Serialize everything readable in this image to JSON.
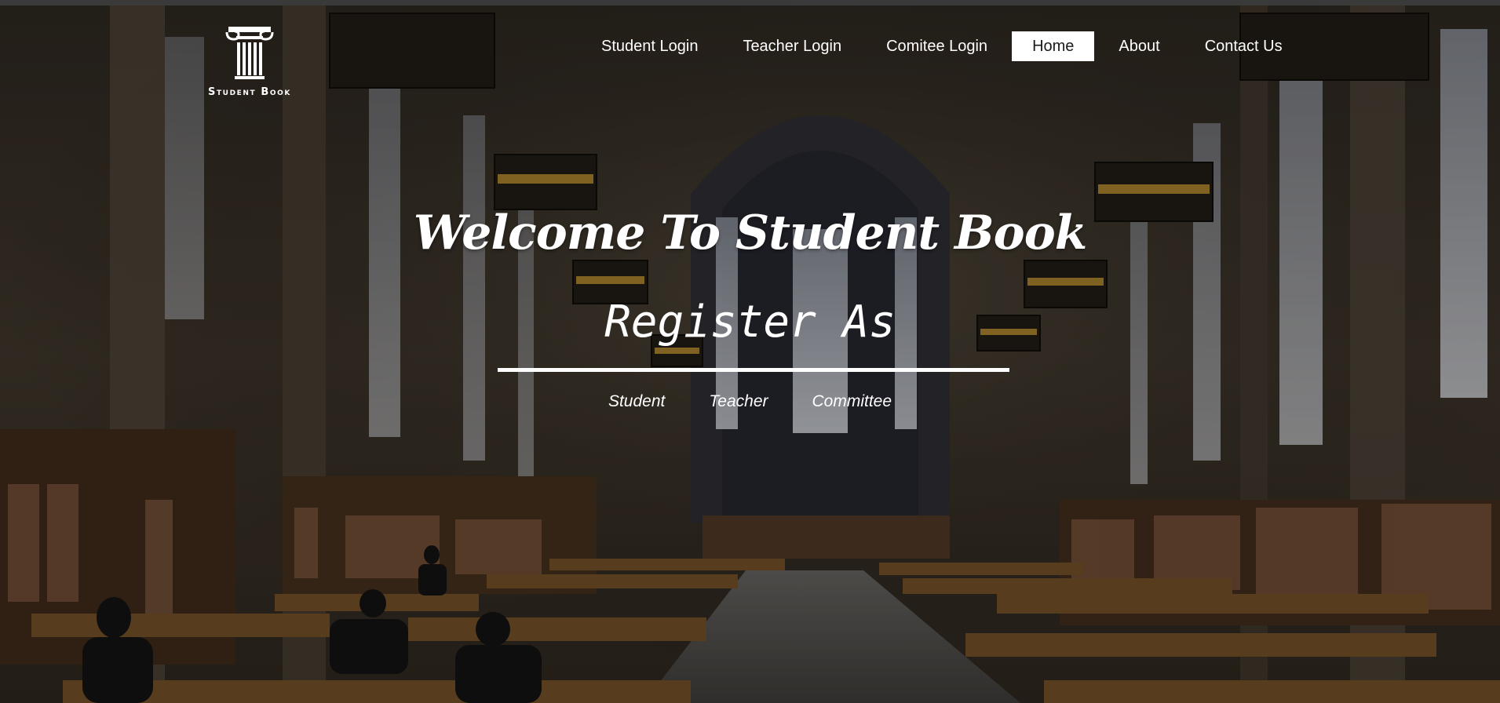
{
  "brand": {
    "logo_icon": "greek-column-icon",
    "name": "Student Book"
  },
  "nav": {
    "items": [
      {
        "label": "Student Login",
        "active": false
      },
      {
        "label": "Teacher Login",
        "active": false
      },
      {
        "label": "Comitee Login",
        "active": false
      },
      {
        "label": "Home",
        "active": true
      },
      {
        "label": "About",
        "active": false
      },
      {
        "label": "Contact Us",
        "active": false
      }
    ]
  },
  "hero": {
    "title": "Welcome To Student Book",
    "subtitle": "Register As",
    "roles": [
      "Student",
      "Teacher",
      "Committee"
    ]
  },
  "colors": {
    "text": "#ffffff",
    "active_nav_bg": "#ffffff",
    "active_nav_text": "#1a1a1a"
  }
}
